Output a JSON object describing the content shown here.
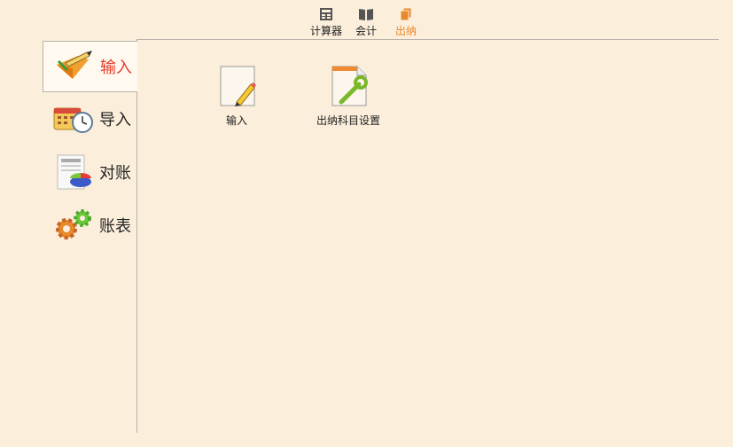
{
  "topbar": {
    "items": [
      {
        "label": "计算器",
        "icon": "calculator-icon"
      },
      {
        "label": "会计",
        "icon": "book-icon"
      },
      {
        "label": "出纳",
        "icon": "pages-icon"
      }
    ],
    "active_index": 2
  },
  "sidebar": {
    "items": [
      {
        "label": "输入",
        "icon": "pencil-checkmark-icon"
      },
      {
        "label": "导入",
        "icon": "calendar-clock-icon"
      },
      {
        "label": "对账",
        "icon": "report-pie-chart-icon"
      },
      {
        "label": "账表",
        "icon": "gears-icon"
      }
    ],
    "active_index": 0
  },
  "main": {
    "tiles": [
      {
        "label": "输入",
        "icon": "document-pencil-icon"
      },
      {
        "label": "出纳科目设置",
        "icon": "document-wrench-icon"
      }
    ]
  },
  "colors": {
    "background": "#fbeedb",
    "accent": "#e8892a",
    "active_label": "#e8392a",
    "divider": "#b9b2a8"
  }
}
